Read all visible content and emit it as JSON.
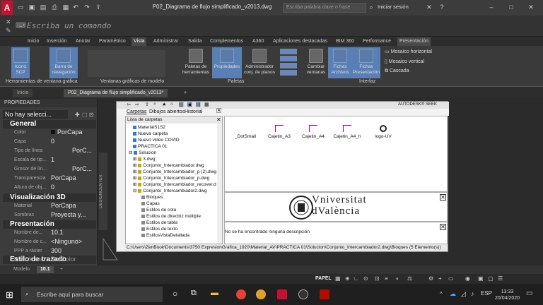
{
  "window": {
    "title": "P02_Diagrama de flujo simplificado_v2013.dwg",
    "search_placeholder": "Escriba palabra clave o frase",
    "login": "Iniciar sesión"
  },
  "command": {
    "placeholder": "Escriba un comando"
  },
  "ribbon_tabs": [
    "Inicio",
    "Inserción",
    "Anotar",
    "Paramétrico",
    "Vista",
    "Administrar",
    "Salida",
    "Complementos",
    "A360",
    "Aplicaciones destacadas",
    "BIM 360",
    "Performance",
    "Presentación"
  ],
  "ribbon_active": "Vista",
  "ribbon": {
    "icono_scp": "Icono\nSCP",
    "barra_nav": "Barra de\nnavegación",
    "paletas_herr": "Paletas de\nherramientas",
    "propiedades": "Propiedades",
    "admin_planos": "Administrador\nconj. de planos",
    "cambiar_ventanas": "Cambiar\nventanas",
    "fichas_archivos": "Fichas\nArchivos",
    "fichas_presentacion": "Fichas\nPresentación",
    "mosaico_h": "Mosaico horizontal",
    "mosaico_v": "Mosaico vertical",
    "cascada": "Cascada",
    "panel_herr_ventana": "Herramientas de ventana gráfica",
    "panel_ventanas_modelo": "Ventanas gráficas de modelo",
    "panel_paletas": "Paletas",
    "panel_interfaz": "Interfaz"
  },
  "doc_tabs": {
    "inicio": "Inicio",
    "active": "P02_Diagrama de flujo simplificado_v2013*"
  },
  "properties": {
    "header": "PROPIEDADES",
    "selection": "No hay selecci...",
    "sections": {
      "general": "General",
      "viz3d": "Visualización 3D",
      "presentacion": "Presentación",
      "estilo": "Estilo de trazado"
    },
    "general_rows": [
      {
        "label": "Color",
        "value": "PorCapa"
      },
      {
        "label": "Capa",
        "value": "0"
      },
      {
        "label": "Tipo de línea",
        "value": "PorC..."
      },
      {
        "label": "Escala de tip...",
        "value": "1"
      },
      {
        "label": "Grosor de lín...",
        "value": "PorC..."
      },
      {
        "label": "Transparencia",
        "value": "PorCapa"
      },
      {
        "label": "Altura de obj...",
        "value": "0"
      }
    ],
    "viz_rows": [
      {
        "label": "Material",
        "value": "PorCapa"
      },
      {
        "label": "Sombras",
        "value": "Proyecta y..."
      }
    ],
    "pres_rows": [
      {
        "label": "Nombre de...",
        "value": "10.1"
      },
      {
        "label": "Nombre de c...",
        "value": "<Ninguno>"
      },
      {
        "label": "PPP a ráster",
        "value": "300"
      }
    ],
    "estilo_rows": [
      {
        "label": "Estilo de traz...",
        "value": "PorColor"
      }
    ]
  },
  "design_center": {
    "tabs": [
      "Carpetas",
      "Dibujos abiertos",
      "Historial"
    ],
    "seek": "AUTODESK® SEEK",
    "tree_label": "Lista de carpetas",
    "tree": [
      "MaterialS1S2",
      "Nueva carpeta",
      "Nuevo video COVID",
      "PRACTICA 01",
      "Solucion",
      "3.dwg",
      "Conjunto_Intercambiador.dwg",
      "Conjunto_Intercambiador_p (2).dwg",
      "Conjunto_Intercambiador_p.dwg",
      "Conjunto_Intercambiador_recover.d",
      "Conjunto_Intercambiador2.dwg",
      "Bloques",
      "Capas",
      "Estilos de cota",
      "Estilos de directriz múltiple",
      "Estilos de tabla",
      "Estilos de texto",
      "EstilosVistaDetallada"
    ],
    "items": [
      "_DotSmall",
      "Cajetin_A3",
      "Cajetin_A4",
      "Cajetin_A4_h",
      "logo-UV"
    ],
    "preview_name_line1": "Vniversitat",
    "preview_name_line2": "dValència",
    "description": "No se ha encontrado ninguna descripción",
    "status_path": "C:\\Users\\ZenBook\\Documents\\3750 ExpresionGrafica_1920\\Material_AV\\PRACTICA 01\\Solucion\\Conjunto_Intercambiador2.dwg\\Bloques (5 Elemento(s))",
    "side_label": "DESIGNCENTER"
  },
  "layout_tabs": {
    "modelo": "Modelo",
    "active": "10.1"
  },
  "status_bar": {
    "papel": "PAPEL"
  },
  "taskbar": {
    "search": "Escribe aquí para buscar",
    "time": "13:33",
    "date": "20/04/2020"
  }
}
